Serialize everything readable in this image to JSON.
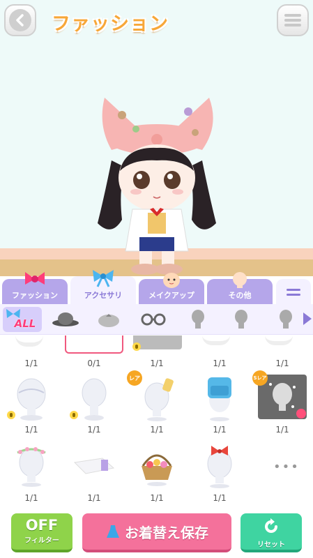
{
  "header": {
    "title": "ファッション"
  },
  "tabs": [
    {
      "label": "ファッション",
      "active": false
    },
    {
      "label": "アクセサリ",
      "active": true
    },
    {
      "label": "メイクアップ",
      "active": false
    },
    {
      "label": "その他",
      "active": false
    }
  ],
  "subcategories": {
    "all_label": "ALL"
  },
  "grid": {
    "row0_counts": [
      "1/1",
      "0/1",
      "1/1",
      "1/1",
      "1/1"
    ],
    "row1_counts": [
      "1/1",
      "1/1",
      "1/1",
      "1/1",
      "1/1"
    ],
    "row2_counts": [
      "1/1",
      "1/1",
      "1/1",
      "1/1"
    ],
    "rare_label": "レア",
    "super_rare_label": "Sレア",
    "more": "•••"
  },
  "bottom": {
    "filter_state": "OFF",
    "filter_label": "フィルター",
    "save_label": "お着替え保存",
    "reset_label": "リセット"
  },
  "colors": {
    "tab_active_text": "#8a79d6",
    "tab_bg": "#b5a6ea",
    "filter_green": "#8fd34a",
    "save_pink": "#f4719b",
    "reset_teal": "#3fd4a1",
    "title_orange": "#f7a738"
  }
}
